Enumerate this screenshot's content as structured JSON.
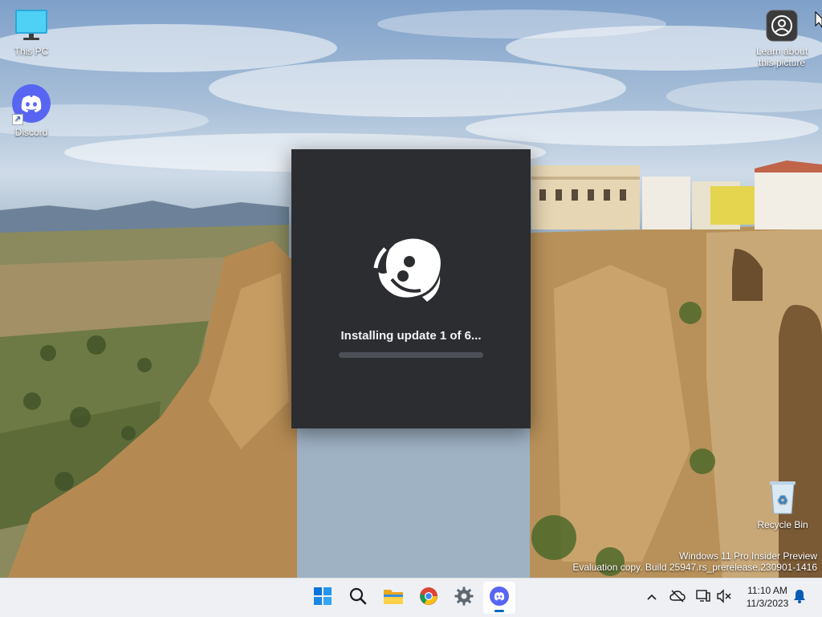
{
  "desktop": {
    "icons": [
      {
        "label": "This PC",
        "icon": "monitor-icon"
      },
      {
        "label": "Discord",
        "icon": "discord-icon"
      },
      {
        "label": "Recycle Bin",
        "icon": "recycle-bin-icon"
      }
    ],
    "learn_about": {
      "line1": "Learn about",
      "line2": "this picture",
      "icon": "camera-icon"
    }
  },
  "splash": {
    "status": "Installing update 1 of 6...",
    "progress": 0,
    "colors": {
      "background": "#2b2d31",
      "track": "#4e5058",
      "fill": "#5865f2"
    }
  },
  "watermark": {
    "line1": "Windows 11 Pro Insider Preview",
    "line2": "Evaluation copy. Build 25947.rs_prerelease.230901-1416"
  },
  "taskbar": {
    "apps": [
      {
        "name": "start",
        "icon": "windows-start-icon"
      },
      {
        "name": "search",
        "icon": "search-icon"
      },
      {
        "name": "file-explorer",
        "icon": "folder-icon"
      },
      {
        "name": "chrome",
        "icon": "chrome-icon"
      },
      {
        "name": "settings",
        "icon": "gear-icon"
      },
      {
        "name": "discord",
        "icon": "discord-icon",
        "active": true
      }
    ],
    "tray": [
      "chevron-up-icon",
      "cloud-offline-icon",
      "network-icon",
      "volume-muted-icon",
      "notification-bell-icon"
    ],
    "time": "11:10 AM",
    "date": "11/3/2023"
  }
}
